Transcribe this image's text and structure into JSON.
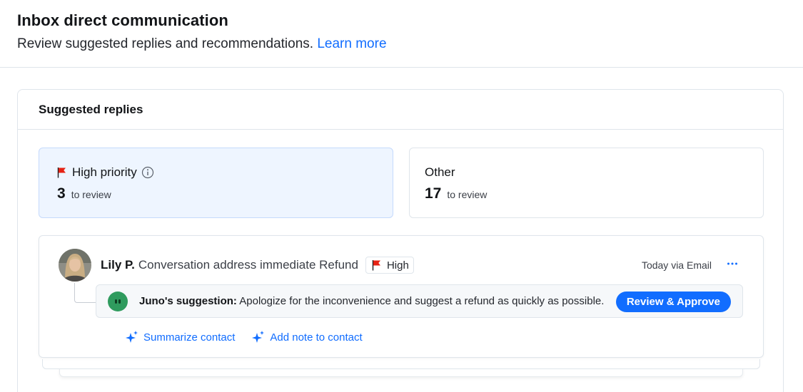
{
  "header": {
    "title": "Inbox direct communication",
    "subtitle": "Review suggested replies and recommendations.",
    "learn_more": "Learn more"
  },
  "panel": {
    "title": "Suggested replies",
    "cards": [
      {
        "title": "High priority",
        "count": "3",
        "count_label": "to review",
        "icon": "flag-icon",
        "selected": true
      },
      {
        "title": "Other",
        "count": "17",
        "count_label": "to review",
        "selected": false
      }
    ]
  },
  "conversation": {
    "contact_name": "Lily P.",
    "subject": "Conversation address immediate Refund",
    "priority": "High",
    "meta": "Today via Email",
    "suggestion_label": "Juno's suggestion:",
    "suggestion_text": "Apologize for the inconvenience and suggest a refund as quickly as possible.",
    "review_button": "Review & Approve",
    "actions": [
      "Summarize contact",
      "Add note to contact"
    ]
  },
  "colors": {
    "accent": "#116dff",
    "flag": "#e62214",
    "bot": "#2f9b5e",
    "selected_card_bg": "#eef5ff"
  }
}
